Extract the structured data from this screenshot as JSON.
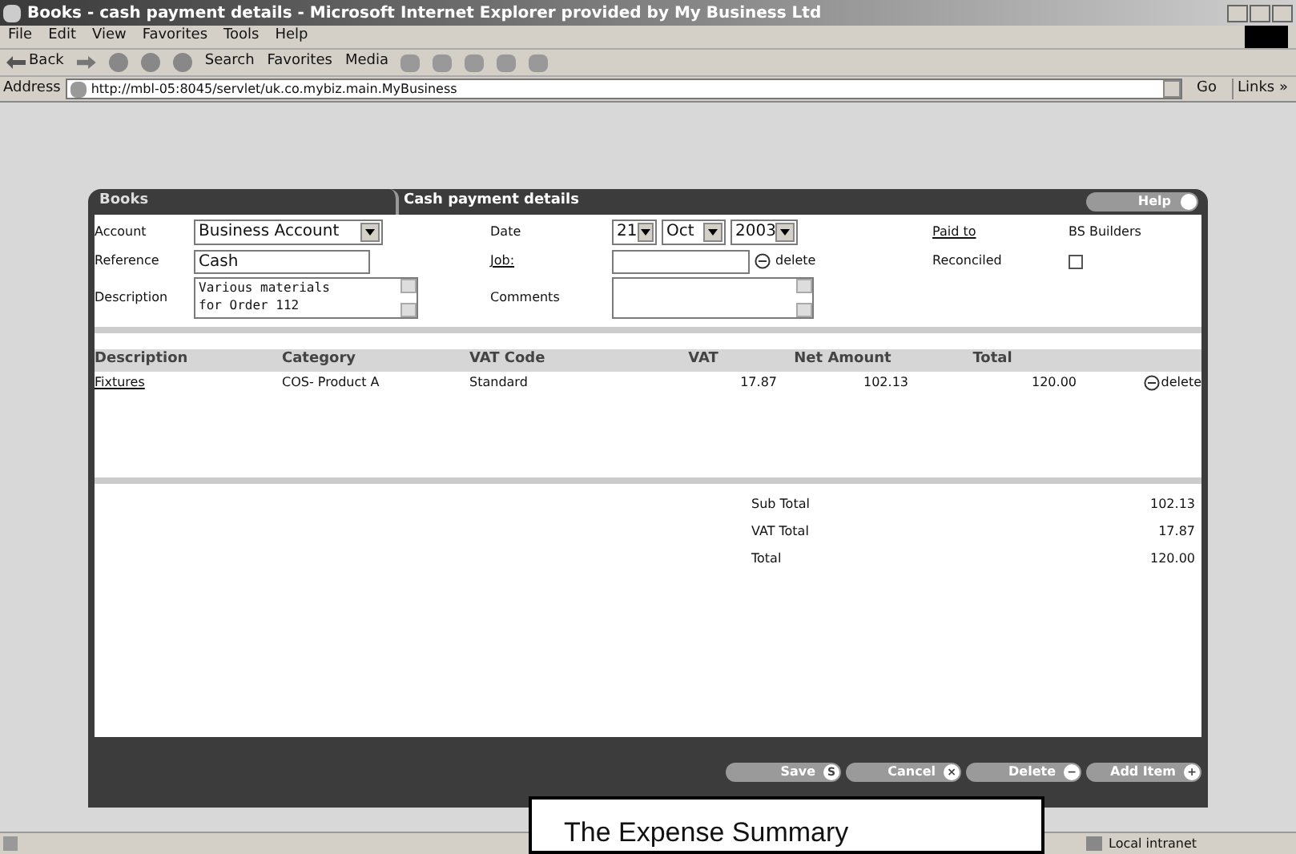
{
  "window": {
    "title": "Books - cash payment details - Microsoft Internet Explorer provided by My Business Ltd"
  },
  "menu": [
    "File",
    "Edit",
    "View",
    "Favorites",
    "Tools",
    "Help"
  ],
  "toolbar": {
    "back": "Back",
    "search": "Search",
    "favorites": "Favorites",
    "media": "Media"
  },
  "address": {
    "label": "Address",
    "url": "http://mbl-05:8045/servlet/uk.co.mybiz.main.MyBusiness",
    "go": "Go",
    "links": "Links »"
  },
  "panel": {
    "tabs": [
      {
        "label": "Books",
        "selected": false
      },
      {
        "label": "Cash payment details",
        "selected": true
      }
    ],
    "help": "Help",
    "form": {
      "account_label": "Account",
      "account": "Business Account",
      "reference_label": "Reference",
      "reference": "Cash",
      "description_label": "Description",
      "description": "Various materials\nfor Order 112",
      "date_label": "Date",
      "day": "21",
      "month": "Oct",
      "year": "2003",
      "job_label": "Job:",
      "job_delete": "delete",
      "comments_label": "Comments",
      "paid_to_label": "Paid to",
      "paid_to": "BS Builders",
      "reconciled_label": "Reconciled",
      "reconciled": false
    },
    "table": {
      "columns": [
        "Description",
        "Category",
        "VAT Code",
        "VAT",
        "Net Amount",
        "Total"
      ],
      "rows": [
        {
          "description": "Fixtures",
          "category": "COS- Product A",
          "vat_code": "Standard",
          "vat": "17.87",
          "net": "102.13",
          "total": "120.00",
          "delete": "delete"
        }
      ]
    },
    "totals": [
      {
        "label": "Sub Total",
        "value": "102.13"
      },
      {
        "label": "VAT Total",
        "value": "17.87"
      },
      {
        "label": "Total",
        "value": "120.00"
      }
    ],
    "buttons": [
      {
        "label": "Save",
        "icon": "S"
      },
      {
        "label": "Cancel",
        "icon": "×"
      },
      {
        "label": "Delete",
        "icon": "−"
      },
      {
        "label": "Add Item",
        "icon": "+"
      }
    ]
  },
  "callout": "The Expense Summary",
  "status_bar": {
    "zone": "Local intranet"
  }
}
